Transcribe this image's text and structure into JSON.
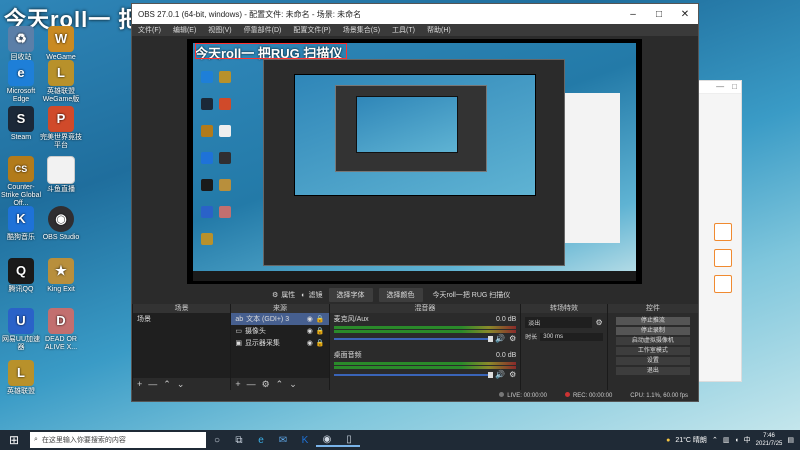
{
  "overlay_title": "今天roll一 把RUG 扫描仪",
  "desktop_icons": [
    {
      "label": "回收站",
      "icon": "recycle-bin-icon",
      "color": "#5b7fa8",
      "glyph": "♻"
    },
    {
      "label": "WeGame",
      "icon": "wegame-icon",
      "color": "#c98a22",
      "glyph": "W"
    },
    {
      "label": "Microsoft Edge",
      "icon": "edge-icon",
      "color": "#1e7fd8",
      "glyph": "e"
    },
    {
      "label": "英雄联盟 WeGame版",
      "icon": "lol-wegame-icon",
      "color": "#b8912b",
      "glyph": "L"
    },
    {
      "label": "Steam",
      "icon": "steam-icon",
      "color": "#1b2838",
      "glyph": "S"
    },
    {
      "label": "完美世界竞技平台",
      "icon": "perfect-world-icon",
      "color": "#d04a2a",
      "glyph": "P"
    },
    {
      "label": "Counter-Strike Global Off...",
      "icon": "csgo-icon",
      "color": "#b27b1b",
      "glyph": "CS"
    },
    {
      "label": "斗鱼直播",
      "icon": "douyu-file-icon",
      "color": "#f2f2f2",
      "glyph": ""
    },
    {
      "label": "酷狗音乐",
      "icon": "kugou-icon",
      "color": "#1e72d8",
      "glyph": "K"
    },
    {
      "label": "OBS Studio",
      "icon": "obs-icon",
      "color": "#302e31",
      "glyph": "◉"
    },
    {
      "label": "腾讯QQ",
      "icon": "qq-icon",
      "color": "#1a1a1a",
      "glyph": "🐧"
    },
    {
      "label": "King Exit",
      "icon": "king-exit-icon",
      "color": "#b88f3c",
      "glyph": "★"
    },
    {
      "label": "网易UU加速器",
      "icon": "uu-icon",
      "color": "#2a62c8",
      "glyph": "U"
    },
    {
      "label": "DEAD OR ALIVE X...",
      "icon": "doa-icon",
      "color": "#c26f6f",
      "glyph": "D"
    },
    {
      "label": "英雄联盟",
      "icon": "lol-icon",
      "color": "#b8912b",
      "glyph": "L"
    }
  ],
  "obs": {
    "title": "OBS 27.0.1 (64-bit, windows) - 配置文件: 未命名 - 场景: 未命名",
    "menu": [
      "文件(F)",
      "编辑(E)",
      "视图(V)",
      "停靠部件(D)",
      "配置文件(P)",
      "场景集合(S)",
      "工具(T)",
      "帮助(H)"
    ],
    "toolbar": {
      "properties": "属性",
      "filters": "滤镜",
      "select_font": "选择字体",
      "select_color": "选择颜色",
      "text_preview": "今天roll一把 RUG 扫描仪"
    },
    "scenes": {
      "header": "场景",
      "items": [
        "场景"
      ]
    },
    "sources": {
      "header": "来源",
      "items": [
        "文本 (GDI+) 3",
        "摄像头",
        "显示器采集"
      ]
    },
    "mixer": {
      "header": "混音器",
      "channels": [
        {
          "name": "麦克风/Aux",
          "db": "0.0 dB"
        },
        {
          "name": "桌面音频",
          "db": "0.0 dB"
        }
      ]
    },
    "transitions": {
      "header": "转场特效",
      "mode": "淡出",
      "duration_label": "时长",
      "duration": "300 ms"
    },
    "controls": {
      "header": "控件",
      "buttons": [
        "停止推流",
        "停止录制",
        "启动虚拟摄像机",
        "工作室模式",
        "设置",
        "退出"
      ]
    },
    "status": {
      "live": "LIVE: 00:00:00",
      "rec": "REC: 00:00:00",
      "cpu": "CPU: 1.1%, 60.00 fps"
    }
  },
  "taskbar": {
    "search_placeholder": "在这里输入你要搜索的内容",
    "weather": "21°C 晴朗",
    "time": "7:46",
    "date": "2021/7/25"
  }
}
